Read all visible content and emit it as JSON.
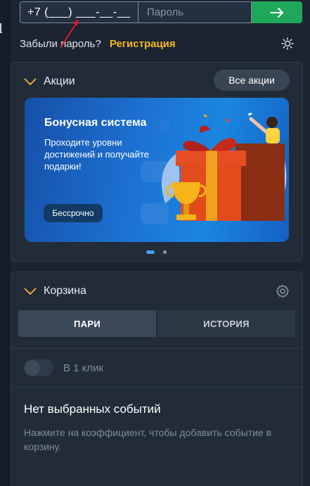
{
  "login": {
    "phone_value": "+7 (___) ___-__-__",
    "password_placeholder": "Пароль",
    "forgot_label": "Забыли пароль?",
    "register_label": "Регистрация"
  },
  "promo": {
    "title": "Акции",
    "all_label": "Все акции",
    "banner": {
      "title": "Бонусная система",
      "text": "Проходите уровни достижений и получайте подарки!",
      "button_label": "Бессрочно"
    },
    "slides_total": 2,
    "active_slide": 1
  },
  "cart": {
    "title": "Корзина",
    "tabs": [
      {
        "label": "ПАРИ",
        "active": true
      },
      {
        "label": "ИСТОРИЯ",
        "active": false
      }
    ],
    "one_click_label": "В 1 клик",
    "one_click_enabled": false,
    "empty_title": "Нет выбранных событий",
    "empty_text": "Нажмите на коэффициент, чтобы добавить событие в корзину."
  },
  "colors": {
    "accent_green": "#1fa85a",
    "register_yellow": "#f5b71a",
    "chevron_yellow": "#f2b632",
    "active_dot": "#4a9ef5",
    "annotation_red": "#e0192a"
  },
  "icons": {
    "submit": "arrow-right-icon",
    "theme": "sun-icon",
    "collapse": "chevron-down-icon",
    "settings": "gear-icon"
  }
}
